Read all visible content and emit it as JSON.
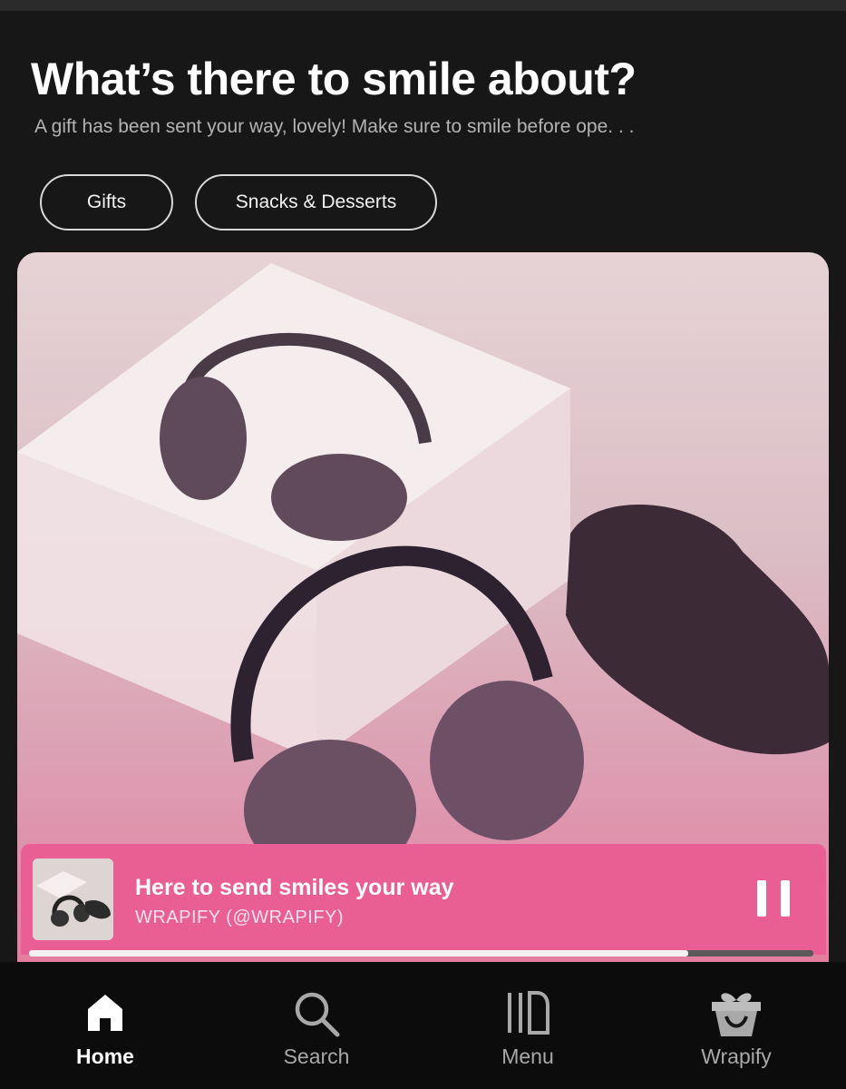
{
  "header": {
    "title": "What’s there to smile about?",
    "subtitle": "A gift has been sent your way, lovely! Make sure to smile before ope. . ."
  },
  "chips": [
    {
      "label": "Gifts"
    },
    {
      "label": "Snacks & Desserts"
    }
  ],
  "now_playing": {
    "title": "Here to send smiles your way",
    "artist": "WRAPIFY (@WRAPIFY)",
    "progress_fraction": 0.84,
    "control": "pause-icon"
  },
  "nav": {
    "items": [
      {
        "label": "Home",
        "icon": "home-icon",
        "active": true
      },
      {
        "label": "Search",
        "icon": "search-icon",
        "active": false
      },
      {
        "label": "Menu",
        "icon": "menu-icon",
        "active": false
      },
      {
        "label": "Wrapify",
        "icon": "gift-icon",
        "active": false
      }
    ]
  },
  "colors": {
    "background": "#171717",
    "player_accent": "#e95e93",
    "nav_background": "#0c0c0c"
  }
}
